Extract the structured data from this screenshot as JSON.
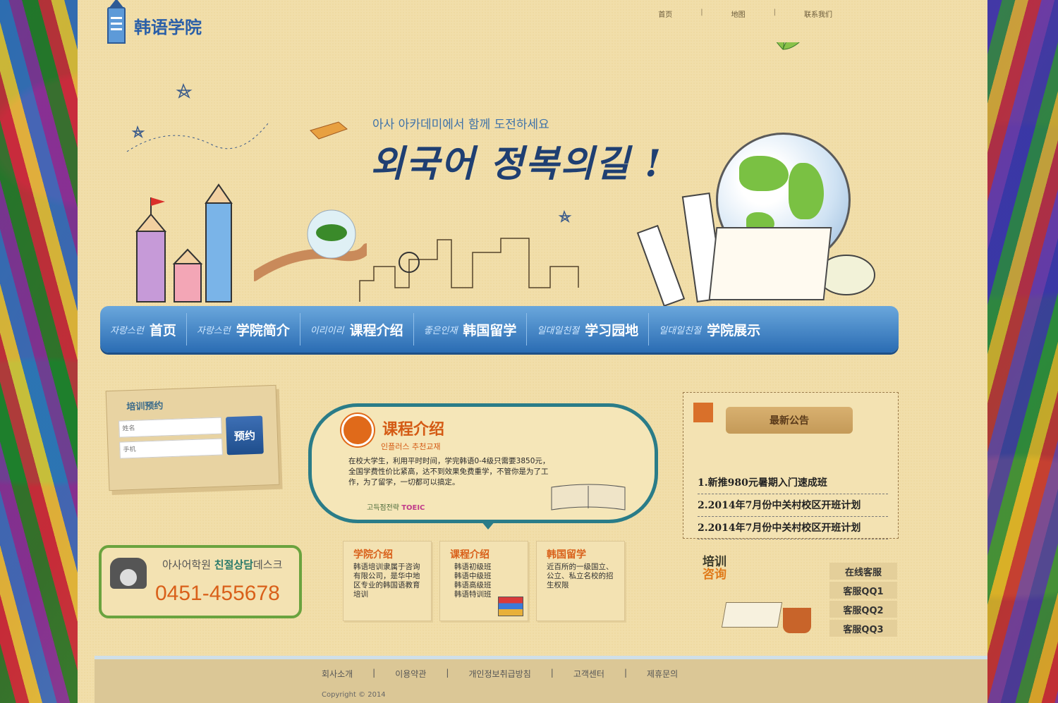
{
  "logo": {
    "text": "韩语学院"
  },
  "top_nav": {
    "items": [
      "首页",
      "地图",
      "联系我们"
    ],
    "separator": "|"
  },
  "banner": {
    "subheading": "아사 아카데미에서 함께 도전하세요",
    "headline": "외국어 정복의길 !"
  },
  "main_nav": {
    "items": [
      {
        "kr": "자랑스런",
        "cn": "首页"
      },
      {
        "kr": "자랑스런",
        "cn": "学院简介"
      },
      {
        "kr": "이리이리",
        "cn": "课程介绍"
      },
      {
        "kr": "좋은인재",
        "cn": "韩国留学"
      },
      {
        "kr": "일대일친절",
        "cn": "学习园地"
      },
      {
        "kr": "일대일친절",
        "cn": "学院展示"
      }
    ]
  },
  "signup": {
    "title": "培训预约",
    "name_placeholder": "姓名",
    "phone_placeholder": "手机",
    "button": "预约"
  },
  "hotline": {
    "label_prefix": "아사어학원",
    "label_highlight": "친절상담",
    "label_suffix": "데스크",
    "number": "0451-455678"
  },
  "course": {
    "title": "课程介绍",
    "subtitle": "인플러스 추천교재",
    "body": "在校大学生，利用平时时间，学完韩语0-4级只需要3850元，全国学费性价比紧高，达不到效果免费重学，不管你是为了工作，为了留学，一切都可以搞定。",
    "footer": "고득점전략",
    "footer_badge": "TOEIC"
  },
  "cards": [
    {
      "title": "学院介绍",
      "body": "韩语培训隶属于咨询有限公司，是华中地区专业的韩国语教育培训"
    },
    {
      "title": "课程介绍",
      "body": "韩语初级班\n韩语中级班\n韩语高级班\n韩语特训班"
    },
    {
      "title": "韩国留学",
      "body": "近百所的一级国立、公立、私立名校的招生权限"
    }
  ],
  "notice": {
    "title": "最新公告",
    "items": [
      "1.新推980元暑期入门速成班",
      "2.2014年7月份中关村校区开班计划",
      "2.2014年7月份中关村校区开班计划"
    ]
  },
  "consult": {
    "heading_line1": "培训",
    "heading_line2": "咨询",
    "items": [
      "在线客服",
      "客服QQ1",
      "客服QQ2",
      "客服QQ3"
    ]
  },
  "footer": {
    "links": [
      "회사소개",
      "이용약관",
      "개인정보취급방침",
      "고객센터",
      "제휴문의"
    ],
    "separator": "|",
    "copyright": "Copyright © 2014"
  }
}
